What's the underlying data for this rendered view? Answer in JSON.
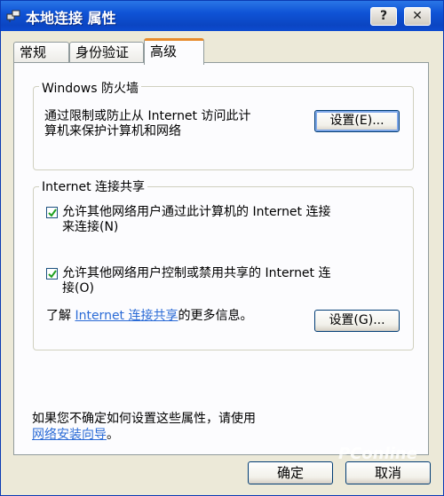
{
  "window": {
    "title": "本地连接 属性",
    "help_label": "?",
    "close_label": "✕"
  },
  "tabs": [
    {
      "label": "常规",
      "active": false
    },
    {
      "label": "身份验证",
      "active": false
    },
    {
      "label": "高级",
      "active": true
    }
  ],
  "firewall": {
    "group_label": "Windows 防火墙",
    "description_line1": "通过限制或防止从 Internet 访问此计",
    "description_line2": "算机来保护计算机和网络",
    "settings_button": "设置(E)..."
  },
  "ics": {
    "group_label": "Internet 连接共享",
    "allow_connect": {
      "line1": "允许其他网络用户通过此计算机的 Internet 连接",
      "line2": "来连接(N)",
      "checked": true
    },
    "allow_control": {
      "line1": "允许其他网络用户控制或禁用共享的 Internet 连",
      "line2": "接(O)",
      "checked": true
    },
    "learn_more_prefix": "了解",
    "learn_more_link": "Internet 连接共享",
    "learn_more_suffix": "的更多信息。",
    "settings_button": "设置(G)..."
  },
  "footer": {
    "text": "如果您不确定如何设置这些属性，请使用",
    "wizard_link": "网络安装向导",
    "wizard_suffix": "。"
  },
  "buttons": {
    "ok": "确定",
    "cancel": "取消"
  },
  "watermark": "PConline"
}
